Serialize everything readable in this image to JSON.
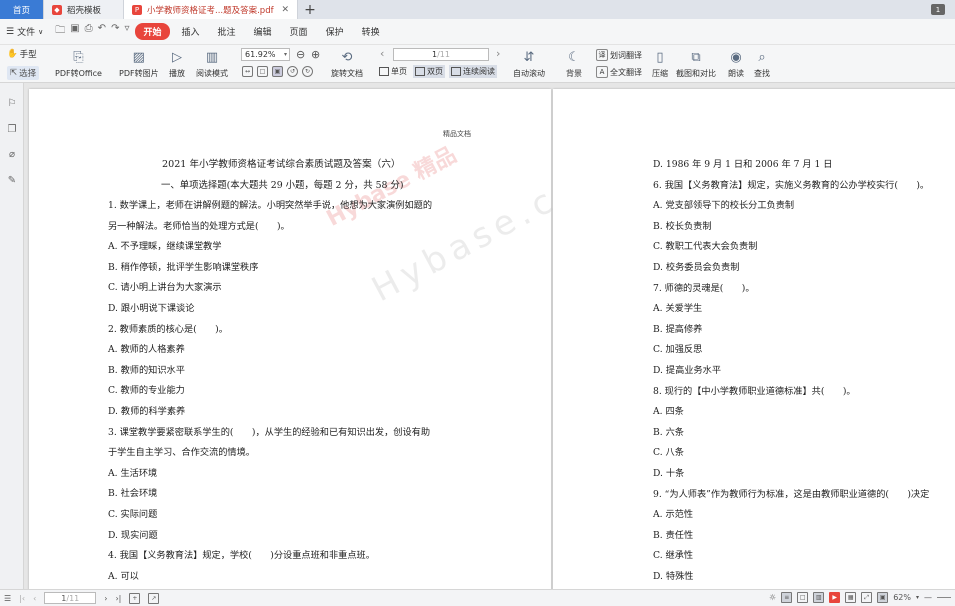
{
  "tabs": [
    {
      "label": "首页",
      "kind": "home"
    },
    {
      "label": "稻壳模板",
      "kind": "template"
    },
    {
      "label": "小学教师资格证考...题及答案.pdf",
      "kind": "pdf"
    }
  ],
  "window_badge": "1",
  "menu": {
    "file": "文件",
    "items": [
      "开始",
      "插入",
      "批注",
      "编辑",
      "页面",
      "保护",
      "转换"
    ],
    "active": "开始"
  },
  "toolbar": {
    "hand": "手型",
    "select": "选择",
    "pdf_to_office": "PDF转Office",
    "pdf_to_image": "PDF转图片",
    "play": "播放",
    "read_mode": "阅读模式",
    "zoom_value": "61.92%",
    "rotate": "旋转文档",
    "page_current": "1",
    "page_total": "/11",
    "single": "单页",
    "double": "双页",
    "continuous": "连续阅读",
    "auto_scroll": "自动滚动",
    "background": "背景",
    "word_translate": "划词翻译",
    "full_translate": "全文翻译",
    "compress": "压缩",
    "screenshot_compare": "截图和对比",
    "read_aloud": "朗读",
    "find": "查找"
  },
  "page1": {
    "header": "精品文档",
    "title": "2021 年小学教师资格证考试综合素质试题及答案（六）",
    "section": "一、单项选择题(本大题共 29 小题，每题 2 分，共 58 分)",
    "lines": [
      "1. 数学课上，老师在讲解例题的解法。小明突然举手说，他想为大家演例如题的",
      "另一种解法。老师恰当的处理方式是(　　)。",
      "A. 不予理睬，继续课堂教学",
      "B. 稍作停顿，批评学生影响课堂秩序",
      "C. 请小明上讲台为大家演示",
      "D. 跟小明说下课谈论",
      "2. 教师素质的核心是(　　)。",
      "A. 教师的人格素养",
      "B. 教师的知识水平",
      "C. 教师的专业能力",
      "D. 教师的科学素养",
      "3. 课堂教学要紧密联系学生的(　　)，从学生的经验和已有知识出发，创设有助",
      "于学生自主学习、合作交流的情境。",
      "A. 生活环境",
      "B. 社会环境",
      "C. 实际问题",
      "D. 现实问题",
      "4. 我国【义务教育法】规定，学校(　　)分设重点班和非重点班。",
      "A. 可以"
    ],
    "watermark_red": "Hybase 精品",
    "watermark_grey": "Hybase.com"
  },
  "page2": {
    "lines": [
      "D. 1986 年 9 月 1 日和 2006 年 7 月 1 日",
      "6. 我国【义务教育法】规定，实施义务教育的公办学校实行(　　)。",
      "A. 党支部领导下的校长分工负责制",
      "B. 校长负责制",
      "C. 教职工代表大会负责制",
      "D. 校务委员会负责制",
      "7. 师德的灵魂是(　　)。",
      "A. 关爱学生",
      "B. 提高修养",
      "C. 加强反思",
      "D. 提高业务水平",
      "8. 现行的【中小学教师职业道德标准】共(　　)。",
      "A. 四条",
      "B. 六条",
      "C. 八条",
      "D. 十条",
      "9. “为人师表”作为教师行为标准，这是由教师职业道德的(　　)决定",
      "A. 示范性",
      "B. 责任性",
      "C. 继承性",
      "D. 特殊性"
    ]
  },
  "statusbar": {
    "page_current": "1",
    "page_total": "/11",
    "zoom": "62%"
  },
  "colors": {
    "accent": "#e8453c",
    "home_tab": "#3a7bd5"
  }
}
